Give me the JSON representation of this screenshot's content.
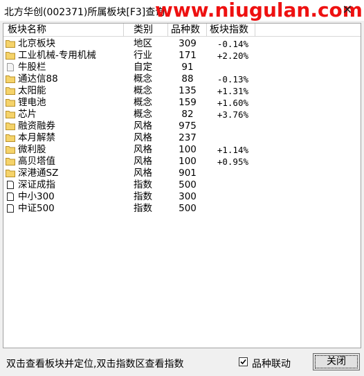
{
  "window": {
    "title": "北方华创(002371)所属板块[F3]查询",
    "watermark": "www.niugulan.com",
    "close_glyph": "✕"
  },
  "columns": {
    "name": "板块名称",
    "type": "类别",
    "count": "品种数",
    "index": "板块指数"
  },
  "rows": [
    {
      "icon": "folder",
      "name": "北京板块",
      "type": "地区",
      "count": "309",
      "index": "-0.14%"
    },
    {
      "icon": "folder",
      "name": "工业机械-专用机械",
      "type": "行业",
      "count": "171",
      "index": "+2.20%"
    },
    {
      "icon": "document",
      "name": "牛股栏",
      "type": "自定",
      "count": "91",
      "index": ""
    },
    {
      "icon": "folder",
      "name": "通达信88",
      "type": "概念",
      "count": "88",
      "index": "-0.13%"
    },
    {
      "icon": "folder",
      "name": "太阳能",
      "type": "概念",
      "count": "135",
      "index": "+1.31%"
    },
    {
      "icon": "folder",
      "name": "锂电池",
      "type": "概念",
      "count": "159",
      "index": "+1.60%"
    },
    {
      "icon": "folder",
      "name": "芯片",
      "type": "概念",
      "count": "82",
      "index": "+3.76%"
    },
    {
      "icon": "folder",
      "name": "融资融券",
      "type": "风格",
      "count": "975",
      "index": ""
    },
    {
      "icon": "folder",
      "name": "本月解禁",
      "type": "风格",
      "count": "237",
      "index": ""
    },
    {
      "icon": "folder",
      "name": "微利股",
      "type": "风格",
      "count": "100",
      "index": "+1.14%"
    },
    {
      "icon": "folder",
      "name": "高贝塔值",
      "type": "风格",
      "count": "100",
      "index": "+0.95%"
    },
    {
      "icon": "folder",
      "name": "深港通SZ",
      "type": "风格",
      "count": "901",
      "index": ""
    },
    {
      "icon": "page",
      "name": "深证成指",
      "type": "指数",
      "count": "500",
      "index": ""
    },
    {
      "icon": "page",
      "name": "中小300",
      "type": "指数",
      "count": "300",
      "index": ""
    },
    {
      "icon": "page",
      "name": "中证500",
      "type": "指数",
      "count": "500",
      "index": ""
    }
  ],
  "footer": {
    "hint": "双击查看板块并定位,双击指数区查看指数",
    "checkbox_label": "品种联动",
    "checkbox_checked": true,
    "close_label": "关闭"
  },
  "colors": {
    "folder_fill": "#f5d36a",
    "folder_stroke": "#b8902a",
    "watermark": "#ee1111"
  }
}
